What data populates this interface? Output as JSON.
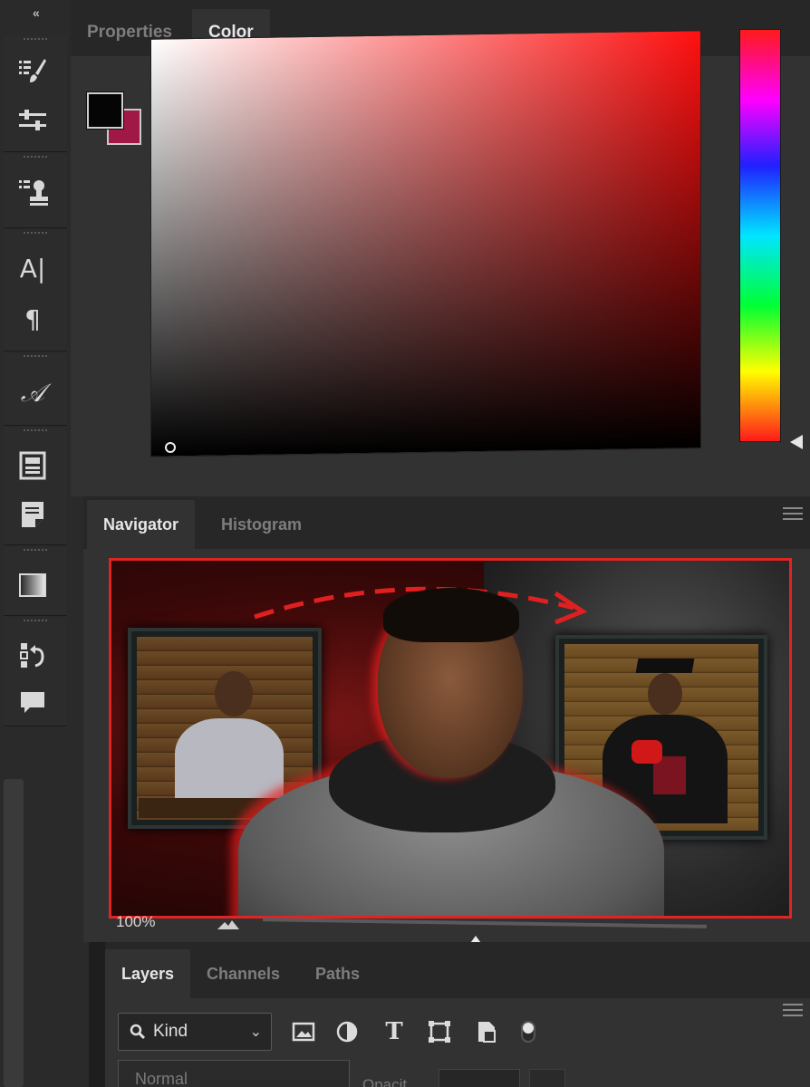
{
  "toolstrip": {
    "collapse_icon": "«",
    "tools": [
      {
        "name": "brush-presets-icon"
      },
      {
        "name": "adjustments-sliders-icon"
      },
      {
        "name": "clone-source-stamp-icon"
      },
      {
        "name": "character-panel-icon",
        "glyph": "A|"
      },
      {
        "name": "paragraph-panel-icon",
        "glyph": "¶"
      },
      {
        "name": "glyphs-panel-icon",
        "glyph": "𝒜"
      },
      {
        "name": "libraries-panel-icon"
      },
      {
        "name": "notes-panel-icon"
      },
      {
        "name": "gradients-panel-icon"
      },
      {
        "name": "history-panel-icon"
      },
      {
        "name": "comments-panel-icon"
      }
    ]
  },
  "color_panel": {
    "tabs": [
      "Properties",
      "Color"
    ],
    "active_tab": "Color",
    "foreground_color": "#050505",
    "background_color": "#a01845",
    "picker_hue": "#ff1010"
  },
  "navigator_panel": {
    "tabs": [
      "Navigator",
      "Histogram"
    ],
    "active_tab": "Navigator",
    "zoom_label": "100%",
    "zoom_slider_fraction": 0.48,
    "frame_color": "#e02424"
  },
  "layers_panel": {
    "tabs": [
      "Layers",
      "Channels",
      "Paths"
    ],
    "active_tab": "Layers",
    "filter_kind_label": "Kind",
    "filter_icons": [
      "image-filter-icon",
      "adjustment-filter-icon",
      "type-filter-icon",
      "shape-filter-icon",
      "smart-object-filter-icon",
      "filter-toggle-icon"
    ],
    "type_icon_glyph": "T",
    "blend_mode": "Normal",
    "opacity_label": "Opacit"
  }
}
